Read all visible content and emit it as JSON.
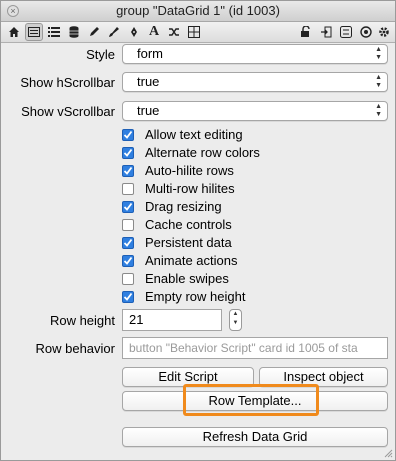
{
  "window": {
    "title": "group \"DataGrid 1\" (id 1003)"
  },
  "toolbar": {
    "icons": [
      "home-icon",
      "card-list-icon",
      "list-icon",
      "database-icon",
      "pencil-icon",
      "brush-icon",
      "pen-icon",
      "text-icon",
      "shuffle-icon",
      "layout-icon",
      "lock-icon",
      "enter-icon",
      "settings-icon",
      "target-icon",
      "gear-icon"
    ]
  },
  "properties": {
    "style_label": "Style",
    "style_value": "form",
    "hscroll_label": "Show hScrollbar",
    "hscroll_value": "true",
    "vscroll_label": "Show vScrollbar",
    "vscroll_value": "true"
  },
  "options": [
    {
      "label": "Allow text editing",
      "checked": true
    },
    {
      "label": "Alternate row colors",
      "checked": true
    },
    {
      "label": "Auto-hilite rows",
      "checked": true
    },
    {
      "label": "Multi-row hilites",
      "checked": false
    },
    {
      "label": "Drag resizing",
      "checked": true
    },
    {
      "label": "Cache controls",
      "checked": false
    },
    {
      "label": "Persistent data",
      "checked": true
    },
    {
      "label": "Animate actions",
      "checked": true
    },
    {
      "label": "Enable swipes",
      "checked": false
    },
    {
      "label": "Empty row height",
      "checked": true
    }
  ],
  "row_height": {
    "label": "Row height",
    "value": "21"
  },
  "row_behavior": {
    "label": "Row behavior",
    "value": "button \"Behavior Script\" card  id 1005 of sta"
  },
  "buttons": {
    "edit_script": "Edit Script",
    "inspect_object": "Inspect object",
    "row_template": "Row Template...",
    "refresh": "Refresh Data Grid"
  },
  "colors": {
    "highlight": "#f08a1c",
    "checkbox_on": "#2f7fe0"
  }
}
